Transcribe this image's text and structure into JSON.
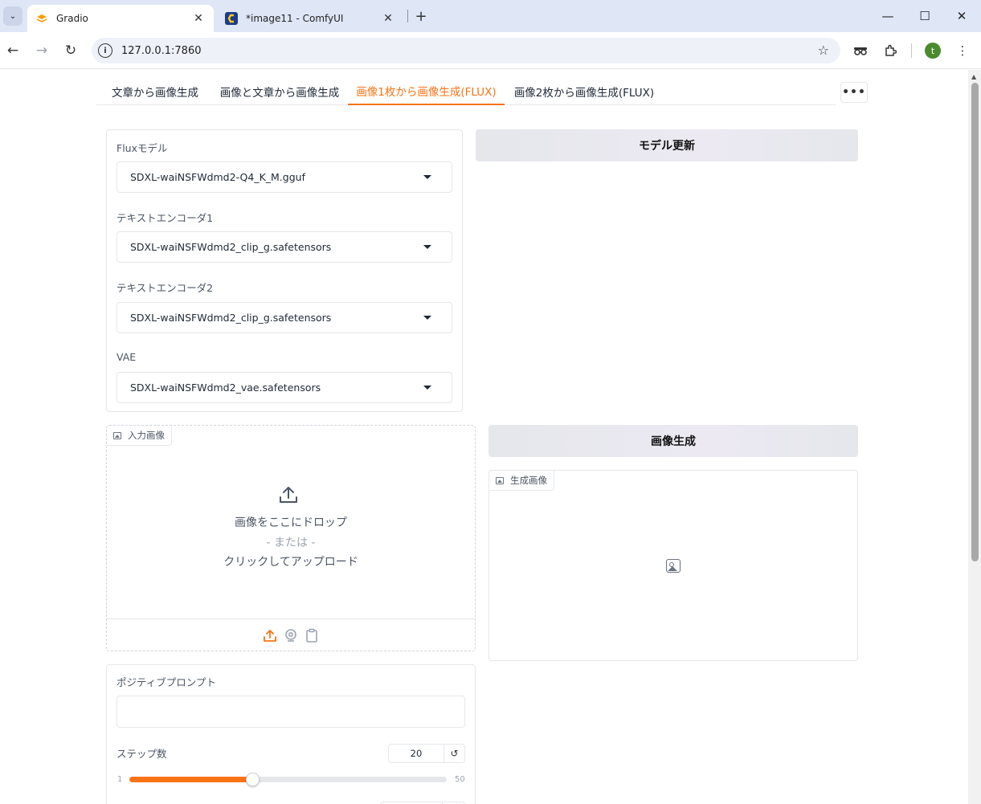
{
  "browser": {
    "tabs": [
      {
        "title": "Gradio",
        "icon": "gradio-logo-icon",
        "active": true
      },
      {
        "title": "*image11 - ComfyUI",
        "icon": "comfyui-logo-icon",
        "active": false
      }
    ],
    "url": "127.0.0.1:7860",
    "profile_initial": "t"
  },
  "gradio_tabs": [
    {
      "label": "文章から画像生成",
      "selected": false
    },
    {
      "label": "画像と文章から画像生成",
      "selected": false
    },
    {
      "label": "画像1枚から画像生成(FLUX)",
      "selected": true
    },
    {
      "label": "画像2枚から画像生成(FLUX)",
      "selected": false
    }
  ],
  "more_button": "•••",
  "models": {
    "flux_model": {
      "label": "Fluxモデル",
      "value": "SDXL-waiNSFWdmd2-Q4_K_M.gguf"
    },
    "text_encoder1": {
      "label": "テキストエンコーダ1",
      "value": "SDXL-waiNSFWdmd2_clip_g.safetensors"
    },
    "text_encoder2": {
      "label": "テキストエンコーダ2",
      "value": "SDXL-waiNSFWdmd2_clip_g.safetensors"
    },
    "vae": {
      "label": "VAE",
      "value": "SDXL-waiNSFWdmd2_vae.safetensors"
    }
  },
  "update_model_button": "モデル更新",
  "input_image": {
    "label": "入力画像",
    "drop_text": "画像をここにドロップ",
    "or_text": "- または -",
    "click_text": "クリックしてアップロード"
  },
  "generate_button": "画像生成",
  "output_image": {
    "label": "生成画像"
  },
  "prompt": {
    "label": "ポジティブプロンプト",
    "value": ""
  },
  "steps": {
    "label": "ステップ数",
    "value": "20",
    "min": "1",
    "max": "50",
    "fraction": 0.3878
  },
  "colors": {
    "accent": "#f97316",
    "border": "#e5e7eb"
  }
}
